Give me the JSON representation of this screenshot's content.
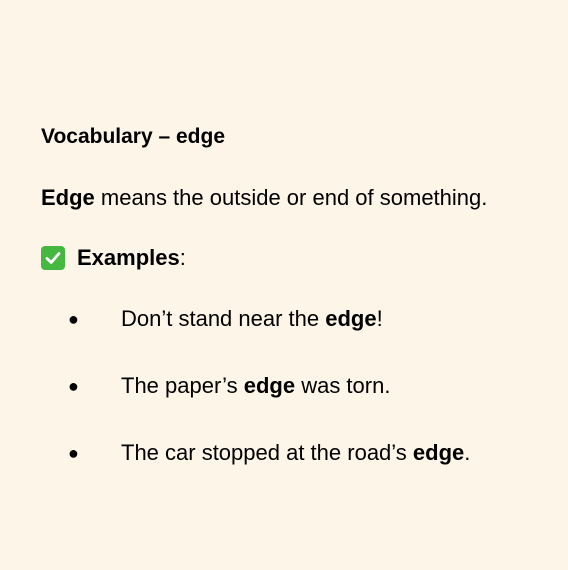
{
  "title": "Vocabulary – edge",
  "definition": {
    "term": "Edge",
    "text": " means the outside or end of something."
  },
  "examples_heading": {
    "label": "Examples",
    "colon": ":",
    "icon": "check-mark-button-icon",
    "icon_color": "#47b83f"
  },
  "bullet_symbol": "●",
  "examples": [
    {
      "before": "Don’t stand near the ",
      "bold": "edge",
      "after": "!"
    },
    {
      "before": "The paper’s ",
      "bold": "edge",
      "after": " was torn."
    },
    {
      "before": "The car stopped at the road’s ",
      "bold": "edge",
      "after": "."
    }
  ]
}
